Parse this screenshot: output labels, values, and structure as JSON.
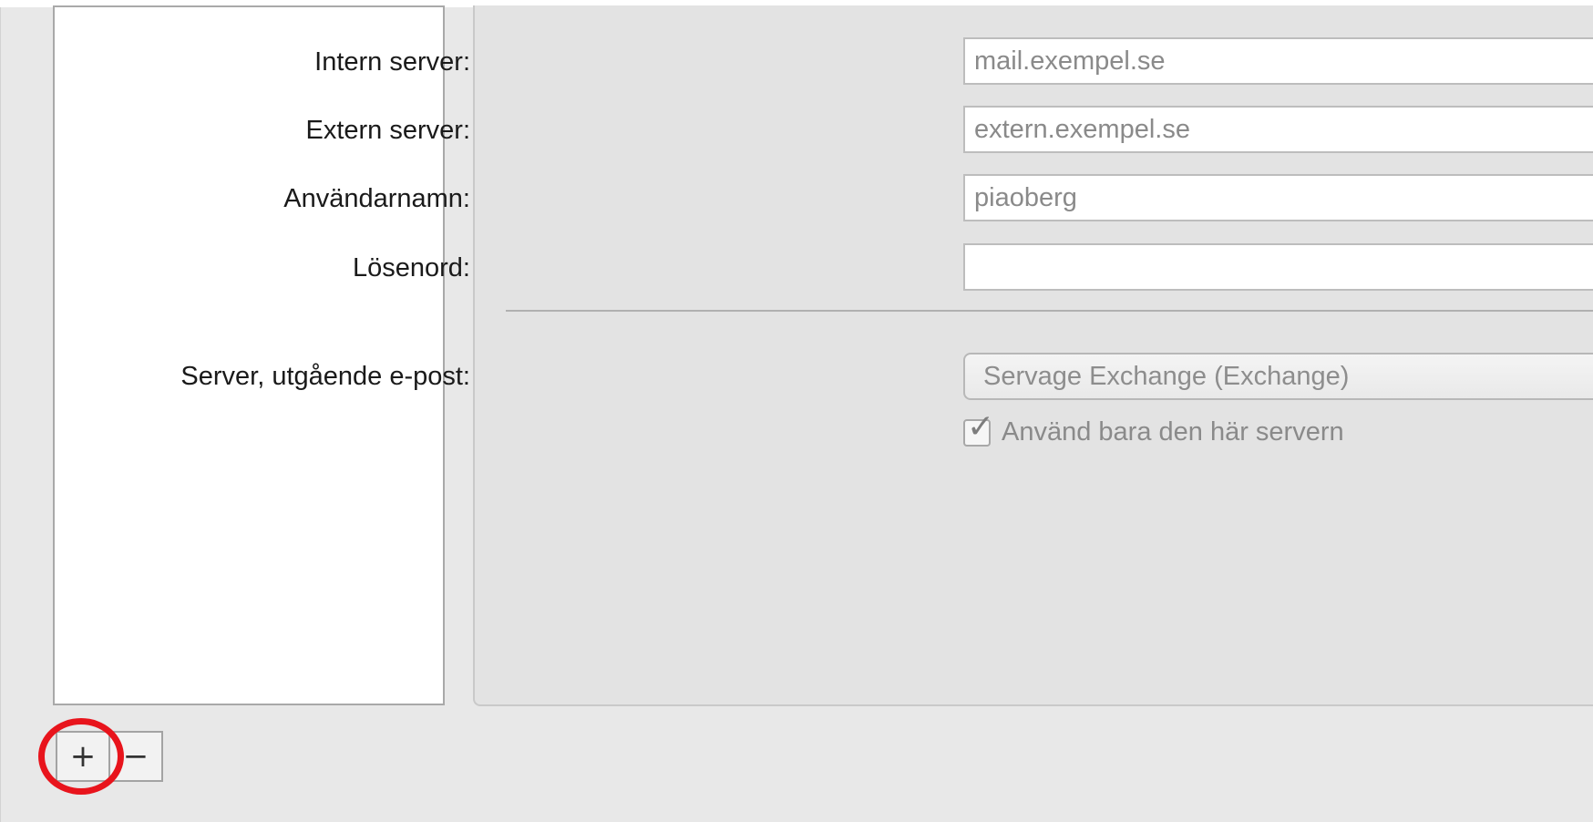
{
  "account_list": {
    "add_label": "+",
    "remove_label": "−"
  },
  "settings": {
    "internal_server": {
      "label": "Intern server:",
      "placeholder": "mail.exempel.se"
    },
    "external_server": {
      "label": "Extern server:",
      "placeholder": "extern.exempel.se"
    },
    "username": {
      "label": "Användarnamn:",
      "placeholder": "piaoberg"
    },
    "password": {
      "label": "Lösenord:",
      "value": ""
    },
    "outgoing_server": {
      "label": "Server, utgående e-post:",
      "selected": "Servage Exchange (Exchange)"
    },
    "only_this_server": {
      "label": "Använd bara den här servern",
      "checked": true
    }
  },
  "annotation": {
    "ring_color": "#e8141c",
    "target": "add-account-button"
  }
}
